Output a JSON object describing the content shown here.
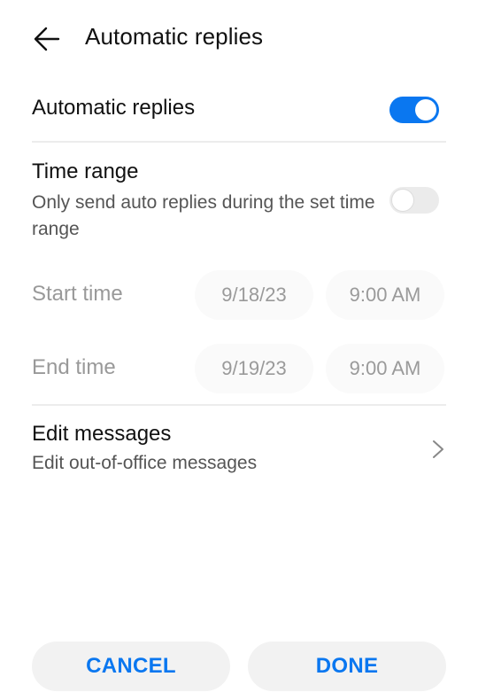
{
  "header": {
    "back_icon": "arrow-left-icon",
    "title": "Automatic replies"
  },
  "automatic_replies": {
    "label": "Automatic replies",
    "enabled": true
  },
  "time_range": {
    "label": "Time range",
    "description": "Only send auto replies during the set time range",
    "enabled": false
  },
  "start_time": {
    "label": "Start time",
    "date": "9/18/23",
    "time": "9:00 AM"
  },
  "end_time": {
    "label": "End time",
    "date": "9/19/23",
    "time": "9:00 AM"
  },
  "edit_messages": {
    "label": "Edit messages",
    "description": "Edit out-of-office messages",
    "chevron_icon": "chevron-right-icon"
  },
  "actions": {
    "cancel_label": "CANCEL",
    "done_label": "DONE"
  },
  "colors": {
    "accent": "#0a77f0",
    "toggle_off": "#ebebeb",
    "button_bg": "#f2f2f2"
  }
}
